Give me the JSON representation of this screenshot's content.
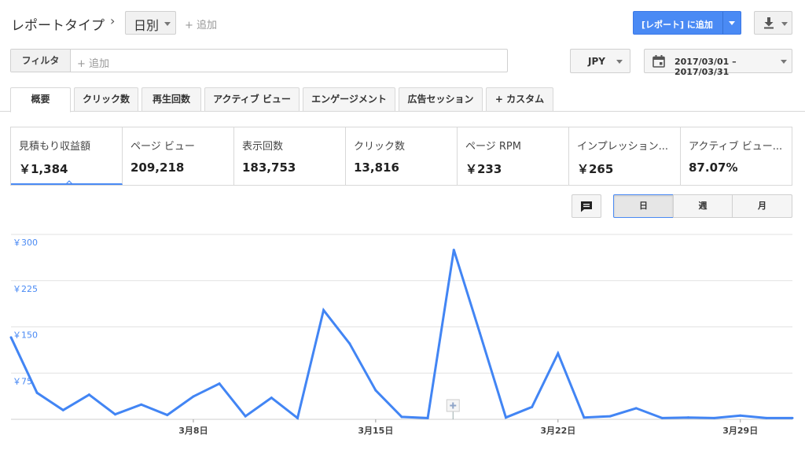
{
  "header": {
    "title": "レポートタイプ",
    "chevron": "›",
    "granularity": "日別",
    "add": "+ 追加",
    "add_to_report": "[レポート] に追加",
    "download_icon": "download-icon"
  },
  "filter": {
    "label": "フィルタ",
    "add": "+ 追加"
  },
  "currency": "JPY",
  "date_range": "2017/03/01 – 2017/03/31",
  "tabs": [
    {
      "label": "概要",
      "active": true
    },
    {
      "label": "クリック数"
    },
    {
      "label": "再生回数"
    },
    {
      "label": "アクティブ ビュー"
    },
    {
      "label": "エンゲージメント"
    },
    {
      "label": "広告セッション"
    },
    {
      "label": "+  カスタム"
    }
  ],
  "metrics": [
    {
      "label": "見積もり収益額",
      "value": "￥1,384",
      "active": true
    },
    {
      "label": "ページ ビュー",
      "value": "209,218"
    },
    {
      "label": "表示回数",
      "value": "183,753"
    },
    {
      "label": "クリック数",
      "value": "13,816"
    },
    {
      "label": "ページ RPM",
      "value": "￥233"
    },
    {
      "label": "インプレッション...",
      "value": "￥265"
    },
    {
      "label": "アクティブ ビュー...",
      "value": "87.07%"
    }
  ],
  "period_toggle": {
    "day": "日",
    "week": "週",
    "month": "月",
    "selected": "日"
  },
  "colors": {
    "accent": "#4a8af4",
    "line": "#4285f4"
  },
  "chart_data": {
    "type": "line",
    "x": [
      "3/1",
      "3/2",
      "3/3",
      "3/4",
      "3/5",
      "3/6",
      "3/7",
      "3/8",
      "3/9",
      "3/10",
      "3/11",
      "3/12",
      "3/13",
      "3/14",
      "3/15",
      "3/16",
      "3/17",
      "3/18",
      "3/19",
      "3/20",
      "3/21",
      "3/22",
      "3/23",
      "3/24",
      "3/25",
      "3/26",
      "3/27",
      "3/28",
      "3/29",
      "3/30",
      "3/31"
    ],
    "x_ticks": [
      {
        "index": 7,
        "label": "3月8日"
      },
      {
        "index": 14,
        "label": "3月15日"
      },
      {
        "index": 21,
        "label": "3月22日"
      },
      {
        "index": 28,
        "label": "3月29日"
      }
    ],
    "series": [
      {
        "values": [
          133,
          43,
          15,
          40,
          8,
          24,
          7,
          37,
          58,
          5,
          35,
          2,
          177,
          123,
          47,
          4,
          2,
          275,
          140,
          3,
          20,
          107,
          3,
          5,
          18,
          2,
          3,
          2,
          6,
          2,
          2
        ]
      }
    ],
    "y_ticks": [
      "￥75",
      "￥150",
      "￥225",
      "￥300"
    ],
    "y_tick_values": [
      75,
      150,
      225,
      300
    ],
    "ylim": [
      0,
      300
    ],
    "grid": true,
    "annotation_marker_index": 17
  }
}
